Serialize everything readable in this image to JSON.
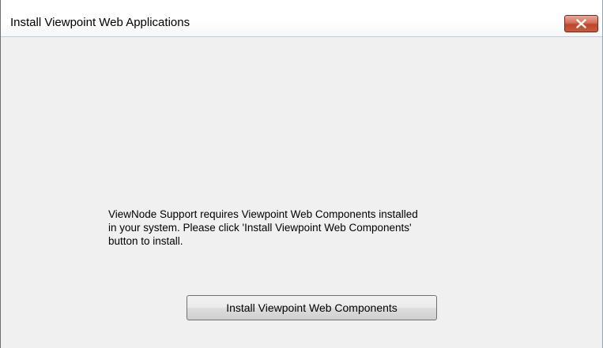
{
  "window": {
    "title": "Install Viewpoint Web Applications",
    "close_icon": "close-x-icon"
  },
  "content": {
    "message_lines": [
      "ViewNode Support requires Viewpoint Web Components installed",
      "in your system. Please click 'Install Viewpoint Web Components'",
      "button to install."
    ],
    "install_button_label": "Install Viewpoint Web Components"
  },
  "colors": {
    "background": "#f0f0f0",
    "close_button": "#c7472b"
  }
}
